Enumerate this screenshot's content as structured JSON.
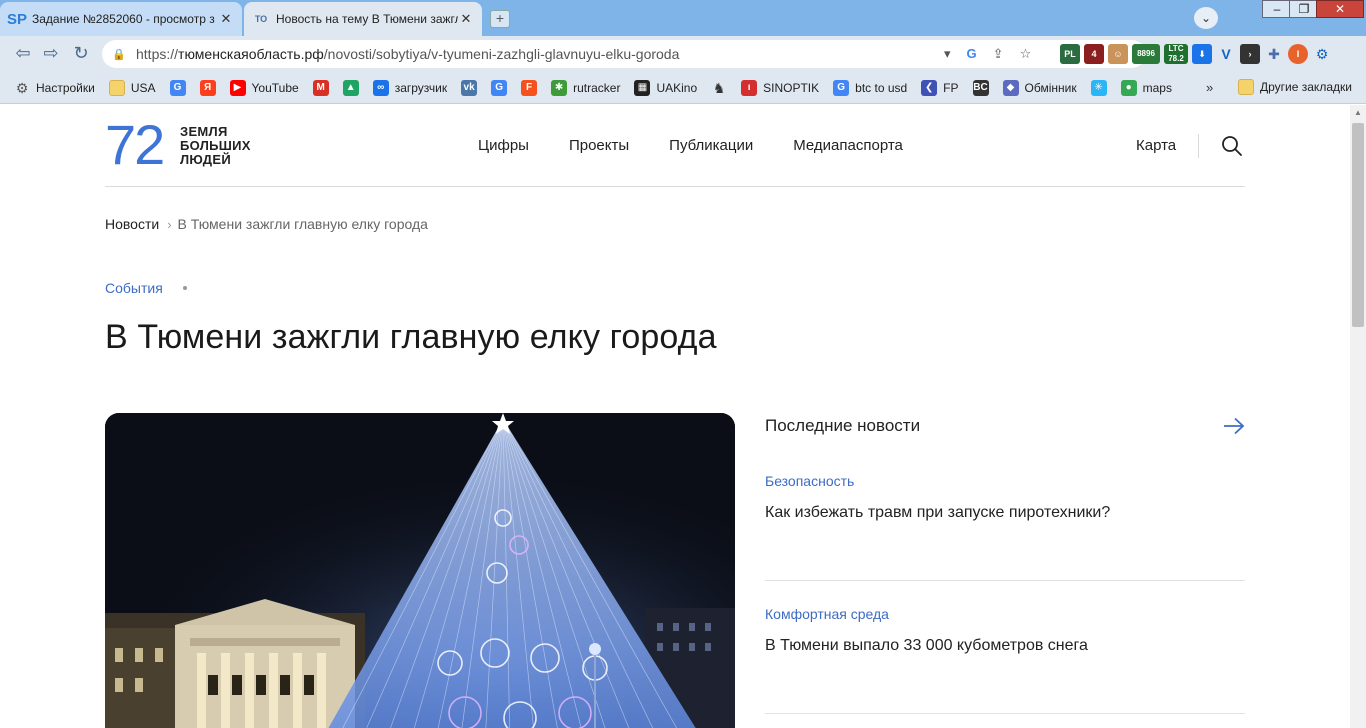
{
  "browser": {
    "tabs": [
      {
        "favicon": "SP",
        "title": "Задание №2852060 - просмотр з",
        "active": false
      },
      {
        "favicon": "ТО",
        "title": "Новость на тему В Тюмени зажгл",
        "active": true
      }
    ],
    "url": {
      "scheme": "https://",
      "host": "тюменскаяобласть.рф",
      "path": "/novosti/sobytiya/v-tyumeni-zazhgli-glavnuyu-elku-goroda"
    },
    "extensions": {
      "pl_badge": "PL",
      "ext_num": "4",
      "btc_price": "8896",
      "ltc_label": "LTC",
      "ltc_price": "78.2",
      "avatar_letter": "I"
    },
    "bookmarks": [
      {
        "label": "Настройки",
        "icon": "gear-icon",
        "color": "#555555"
      },
      {
        "label": "USA",
        "icon": "folder-icon",
        "color": "#f4d36b"
      },
      {
        "label": "",
        "icon": "google-icon",
        "color": "#4285f4"
      },
      {
        "label": "",
        "icon": "yandex-icon",
        "color": "#fc3f1d"
      },
      {
        "label": "YouTube",
        "icon": "youtube-icon",
        "color": "#ff0000"
      },
      {
        "label": "",
        "icon": "gmail-icon",
        "color": "#d93025"
      },
      {
        "label": "",
        "icon": "drive-icon",
        "color": "#1fa463"
      },
      {
        "label": "загрузчик",
        "icon": "infinity-icon",
        "color": "#1a73e8"
      },
      {
        "label": "",
        "icon": "vk-icon",
        "color": "#4a76a8"
      },
      {
        "label": "",
        "icon": "translate-icon",
        "color": "#4285f4"
      },
      {
        "label": "",
        "icon": "f-icon",
        "color": "#f4511e"
      },
      {
        "label": "rutracker",
        "icon": "rutracker-icon",
        "color": "#3e9b3a"
      },
      {
        "label": "UAKino",
        "icon": "film-icon",
        "color": "#222222"
      },
      {
        "label": "",
        "icon": "chess-icon",
        "color": "#333333"
      },
      {
        "label": "SINOPTIK",
        "icon": "thermometer-icon",
        "color": "#d32f2f"
      },
      {
        "label": "btc to usd",
        "icon": "google-icon",
        "color": "#4285f4"
      },
      {
        "label": "FP",
        "icon": "chevron-icon",
        "color": "#3f51b5"
      },
      {
        "label": "",
        "icon": "bc-icon",
        "color": "#333333"
      },
      {
        "label": "Обмінник",
        "icon": "diamond-icon",
        "color": "#5c6bc0"
      },
      {
        "label": "",
        "icon": "star-burst-icon",
        "color": "#29b6f6"
      },
      {
        "label": "maps",
        "icon": "map-pin-icon",
        "color": "#34a853"
      }
    ],
    "bookmarks_more": "»",
    "other_bookmarks": "Другие закладки"
  },
  "site": {
    "logo_number": "72",
    "logo_lines": [
      "ЗЕМЛЯ",
      "БОЛЬШИХ",
      "ЛЮДЕЙ"
    ],
    "nav": [
      "Цифры",
      "Проекты",
      "Публикации",
      "Медиапаспорта"
    ],
    "map_link": "Карта"
  },
  "breadcrumb": {
    "root": "Новости",
    "separator": "›",
    "current": "В Тюмени зажгли главную елку города"
  },
  "article": {
    "category": "События",
    "title": "В Тюмени зажгли главную елку города",
    "image": "christmas-tree-photo"
  },
  "sidebar": {
    "title": "Последние новости",
    "items": [
      {
        "category": "Безопасность",
        "title": "Как избежать травм при запуске пиротехники?"
      },
      {
        "category": "Комфортная среда",
        "title": "В Тюмени выпало 33 000 кубометров снега"
      }
    ]
  },
  "colors": {
    "accent": "#3d74d6",
    "link": "#3d6cc4",
    "chrome": "#dfe7f0",
    "titlebar": "#7fb4e9"
  }
}
